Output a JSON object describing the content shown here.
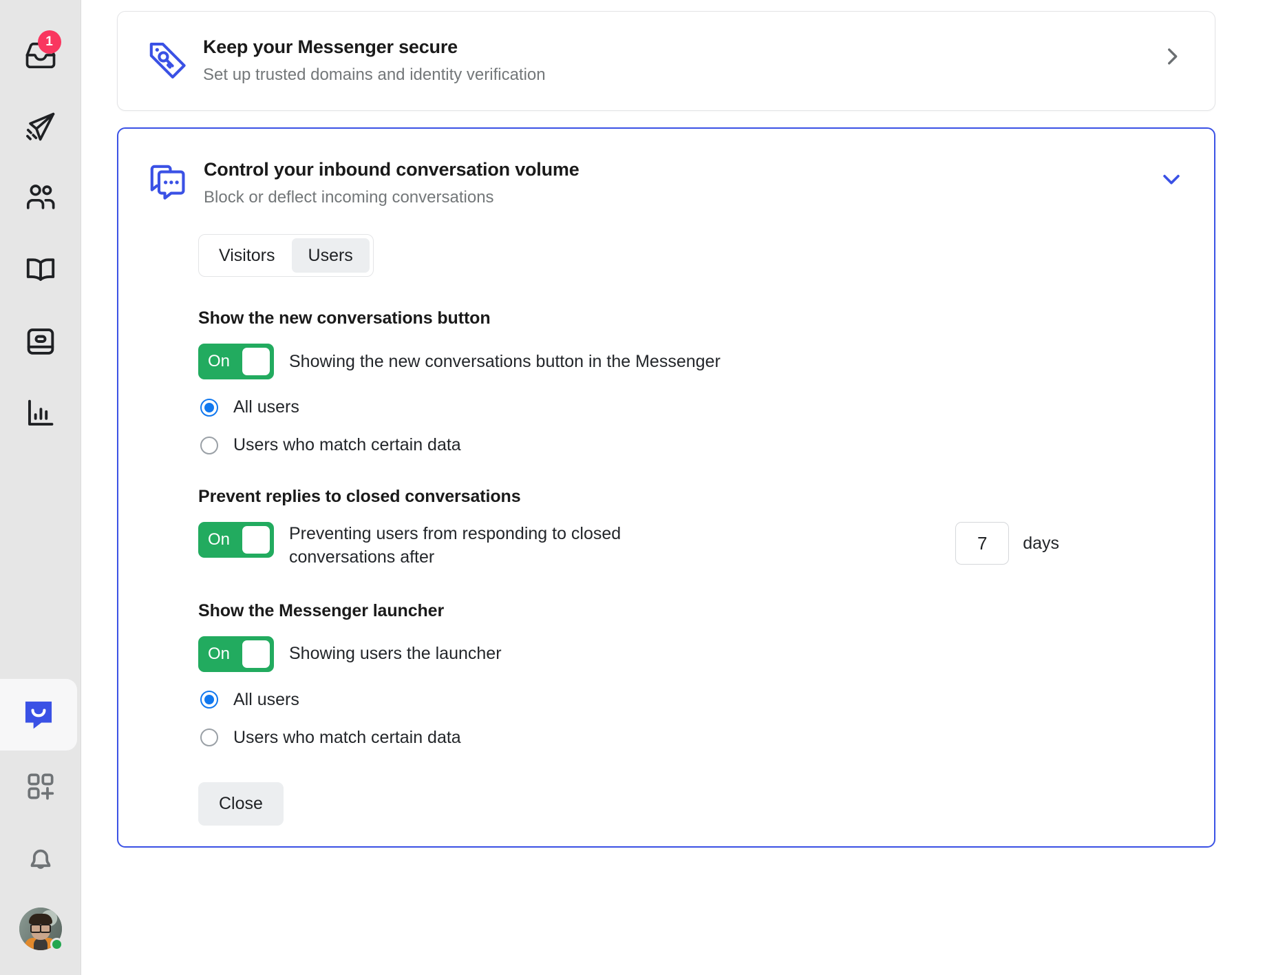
{
  "sidebar": {
    "items": [
      {
        "name": "inbox-icon",
        "label": "Inbox",
        "badge": "1"
      },
      {
        "name": "send-icon",
        "label": "Outbound",
        "badge": null
      },
      {
        "name": "contacts-icon",
        "label": "Contacts",
        "badge": null
      },
      {
        "name": "book-icon",
        "label": "Articles",
        "badge": null
      },
      {
        "name": "card-icon",
        "label": "Tickets",
        "badge": null
      },
      {
        "name": "chart-icon",
        "label": "Reports",
        "badge": null
      },
      {
        "name": "messenger-icon",
        "label": "Messenger",
        "badge": null
      },
      {
        "name": "apps-add-icon",
        "label": "Apps",
        "badge": null
      },
      {
        "name": "bell-icon",
        "label": "Notifications",
        "badge": null
      }
    ],
    "avatar": {
      "name": "avatar",
      "status": "online"
    },
    "badge_color": "#f9365f",
    "selected_index": 6
  },
  "cards": {
    "secure": {
      "title": "Keep your Messenger secure",
      "subtitle": "Set up trusted domains and identity verification",
      "icon": "tag-key-icon",
      "chevron": "chevron-right-icon",
      "accent": "#3a51e5"
    },
    "volume": {
      "title": "Control your inbound conversation volume",
      "subtitle": "Block or deflect incoming conversations",
      "icon": "conversations-icon",
      "chevron": "chevron-down-icon",
      "border_color": "#3a51e5",
      "tabs": [
        {
          "label": "Visitors",
          "active": false
        },
        {
          "label": "Users",
          "active": true
        }
      ],
      "sections": [
        {
          "title": "Show the new conversations button",
          "toggle": {
            "state": "On",
            "label": "Showing the new conversations button in the Messenger",
            "color": "#22ab5f"
          },
          "options": [
            {
              "label": "All users",
              "selected": true
            },
            {
              "label": "Users who match certain data",
              "selected": false
            }
          ]
        },
        {
          "title": "Prevent replies to closed conversations",
          "toggle": {
            "state": "On",
            "label": "Preventing users from responding to closed conversations after",
            "color": "#22ab5f"
          },
          "days_value": "7",
          "days_placeholder": "7",
          "days_label": "days"
        },
        {
          "title": "Show the Messenger launcher",
          "toggle": {
            "state": "On",
            "label": "Showing users the launcher",
            "color": "#22ab5f"
          },
          "options": [
            {
              "label": "All users",
              "selected": true
            },
            {
              "label": "Users who match certain data",
              "selected": false
            }
          ]
        }
      ],
      "close_label": "Close"
    }
  }
}
